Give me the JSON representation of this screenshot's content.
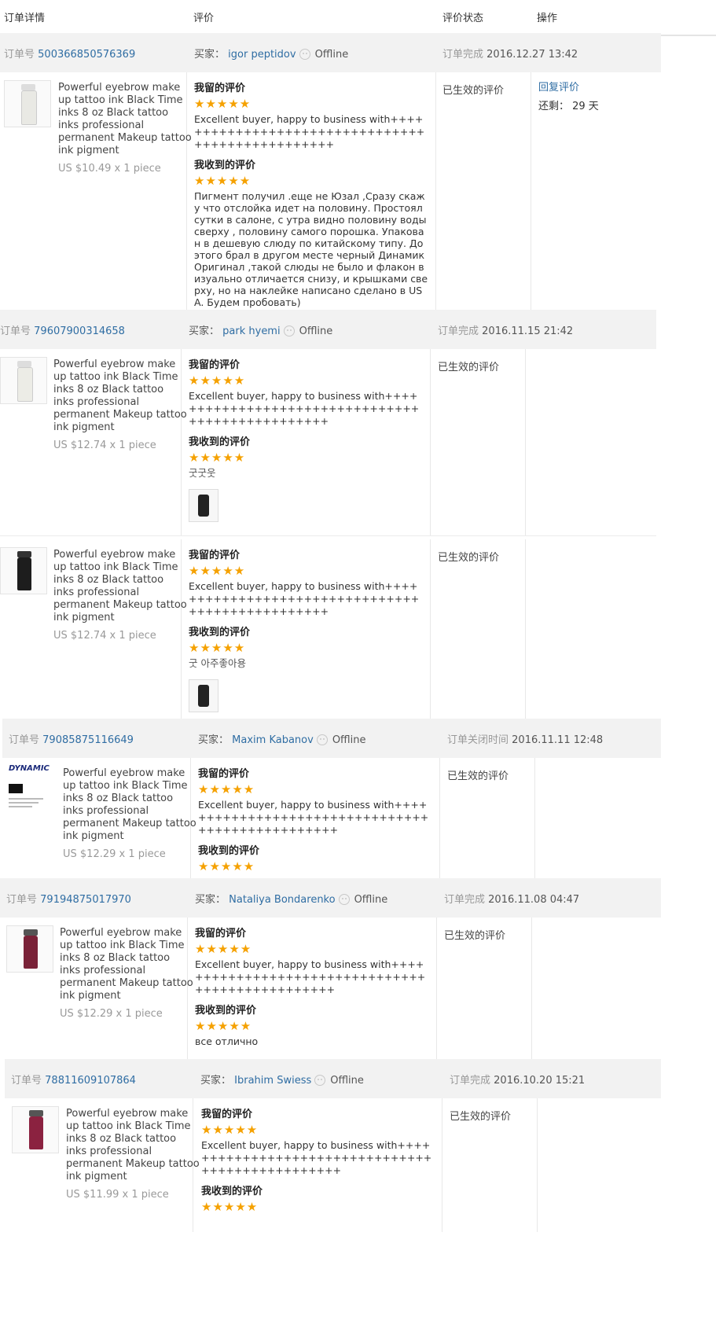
{
  "header": {
    "col_order": "订单详情",
    "col_review": "评价",
    "col_status": "评价状态",
    "col_action": "操作"
  },
  "labels": {
    "order_no": "订单号",
    "buyer": "买家：",
    "offline": "Offline",
    "left_review": "我留的评价",
    "received_review": "我收到的评价",
    "stars": "★★★★★",
    "status_effective": "已生效的评价"
  },
  "product": {
    "title": "Powerful eyebrow make up tattoo ink Black Time inks 8 oz Black tattoo inks professional permanent Makeup tattoo ink pigment"
  },
  "my_review_text": "Excellent buyer, happy to business with+++++++++++++++++++++++++++++++++++++++++++++++++",
  "orders": [
    {
      "order_id": "500366850576369",
      "buyer": "igor peptidov",
      "completion_label": "订单完成",
      "date": "2016.12.27 13:42",
      "items": [
        {
          "price": "US $10.49 x 1 piece",
          "received_text": "Пигмент получил .еще не Юзал ,Сразу скажу что отслойка идет на половину. Простоял сутки в салоне, с утра видно половину воды сверху , половину самого порошка. Упакован в дешевую слюду по китайскому типу. До этого брал в другом месте черный Динамик Оригинал ,такой слюды не было и флакон визуально отличается снизу, и крышками сверху, но на наклейке написано сделано в USA. Будем пробовать)",
          "action_reply": "回复评价",
          "remaining": "还剩： 29 天"
        }
      ]
    },
    {
      "order_id": "79607900314658",
      "buyer": "park hyemi",
      "completion_label": "订单完成",
      "date": "2016.11.15 21:42",
      "items": [
        {
          "price": "US $12.74 x 1 piece",
          "received_text": "굿굿웃"
        },
        {
          "price": "US $12.74 x 1 piece",
          "received_text": "굿 아주좋아용"
        }
      ]
    },
    {
      "order_id": "79085875116649",
      "buyer": "Maxim Kabanov",
      "completion_label": "订单关闭时间",
      "date": "2016.11.11 12:48",
      "items": [
        {
          "price": "US $12.29 x 1 piece"
        }
      ]
    },
    {
      "order_id": "79194875017970",
      "buyer": "Nataliya Bondarenko",
      "completion_label": "订单完成",
      "date": "2016.11.08 04:47",
      "items": [
        {
          "price": "US $12.29 x 1 piece",
          "received_text": "все отлично"
        }
      ]
    },
    {
      "order_id": "78811609107864",
      "buyer": "Ibrahim Swiess",
      "completion_label": "订单完成",
      "date": "2016.10.20 15:21",
      "items": [
        {
          "price": "US $11.99 x 1 piece"
        }
      ]
    }
  ],
  "logo_text": "DYNAMIC"
}
